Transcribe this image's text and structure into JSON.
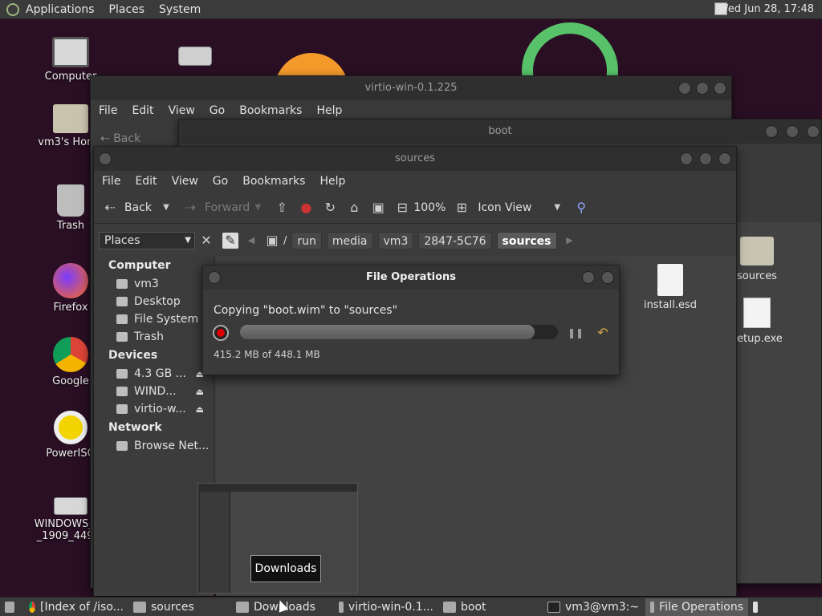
{
  "top_panel": {
    "menus": [
      "Applications",
      "Places",
      "System"
    ],
    "clock": "Wed Jun 28, 17:48"
  },
  "desktop": {
    "icons": [
      {
        "label": "Computer",
        "icon": "computer-icon"
      },
      {
        "label": "vm3's Home",
        "icon": "home-folder-icon"
      },
      {
        "label": "Trash",
        "icon": "trash-icon"
      },
      {
        "label": "Firefox",
        "icon": "firefox-icon"
      },
      {
        "label": "Google",
        "icon": "chrome-icon"
      },
      {
        "label": "PowerISO",
        "icon": "poweriso-icon"
      },
      {
        "label": "WINDOWS_10_1909_449_L",
        "icon": "drive-icon"
      }
    ]
  },
  "windows": {
    "back1_title": "virtio-win-0.1.225",
    "back1_menu": [
      "File",
      "Edit",
      "View",
      "Go",
      "Bookmarks",
      "Help"
    ],
    "back1_back": "Back",
    "back2_title": "boot",
    "back2_files": [
      {
        "label": "sources",
        "type": "folder"
      },
      {
        "label": "setup.exe",
        "type": "exe"
      }
    ],
    "main": {
      "title": "sources",
      "menu": [
        "File",
        "Edit",
        "View",
        "Go",
        "Bookmarks",
        "Help"
      ],
      "toolbar": {
        "back": "Back",
        "forward": "Forward",
        "zoom": "100%",
        "view_mode": "Icon View"
      },
      "places_select": "Places",
      "breadcrumbs": [
        "run",
        "media",
        "vm3",
        "2847-5C76",
        "sources"
      ],
      "sidebar": {
        "computer_header": "Computer",
        "computer_items": [
          "vm3",
          "Desktop",
          "File System",
          "Trash"
        ],
        "devices_header": "Devices",
        "device_items": [
          "4.3 GB ...",
          "WIND...",
          "virtio-w..."
        ],
        "network_header": "Network",
        "network_items": [
          "Browse Net..."
        ]
      },
      "files": [
        {
          "label": "install.esd",
          "type": "document"
        }
      ]
    }
  },
  "file_operations": {
    "title": "File Operations",
    "status": "Copying \"boot.wim\" to \"sources\"",
    "progress_fraction": 0.927,
    "size_text": "415.2 MB of 448.1 MB"
  },
  "preview": {
    "tooltip": "Downloads"
  },
  "taskbar": {
    "tasks": [
      {
        "label": "[Index of /iso...",
        "icon": "chrome-icon",
        "active": false
      },
      {
        "label": "sources",
        "icon": "folder-icon",
        "active": false
      },
      {
        "label": "Downloads",
        "icon": "folder-icon",
        "active": false
      },
      {
        "label": "virtio-win-0.1...",
        "icon": "drive-icon",
        "active": false
      },
      {
        "label": "boot",
        "icon": "folder-icon",
        "active": false
      },
      {
        "label": "vm3@vm3:~",
        "icon": "terminal-icon",
        "active": false
      },
      {
        "label": "File Operations",
        "icon": "window-icon",
        "active": true
      }
    ]
  },
  "colors": {
    "desktop_bg": "#2a0f24",
    "cancel_red": "#dd0000",
    "panel_bg": "#3b3b3b"
  }
}
